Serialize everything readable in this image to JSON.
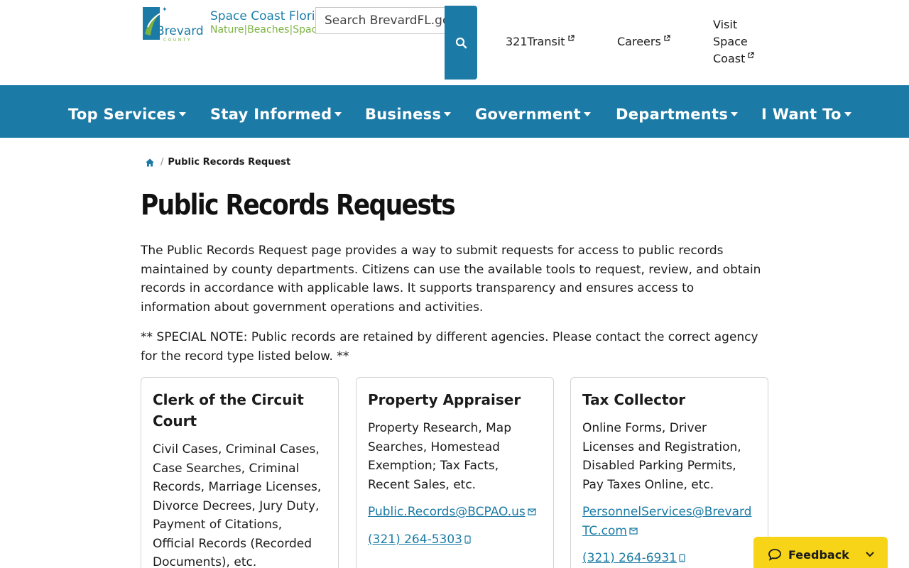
{
  "header": {
    "logo": {
      "word": "Brevard",
      "sub": "COUNTY"
    },
    "site_title": "Space Coast Florida",
    "tagline": [
      "Nature",
      "Beaches",
      "Space"
    ],
    "search": {
      "placeholder": "Search BrevardFL.gov"
    },
    "util_links": [
      {
        "label": "321Transit"
      },
      {
        "label": "Careers"
      },
      {
        "label": "Visit Space Coast"
      }
    ]
  },
  "nav": {
    "items": [
      {
        "label": "Top Services"
      },
      {
        "label": "Stay Informed"
      },
      {
        "label": "Business"
      },
      {
        "label": "Government"
      },
      {
        "label": "Departments"
      },
      {
        "label": "I Want To"
      }
    ]
  },
  "breadcrumb": {
    "current": "Public Records Request"
  },
  "page": {
    "title": "Public Records Requests",
    "intro": "The Public Records Request page provides a way to submit requests for access to public records maintained by county departments. Citizens can use the available tools to request, review, and obtain records in accordance with applicable laws. It supports transparency and ensures access to information about government operations and activities.",
    "note": "** SPECIAL NOTE: Public records are retained by different agencies. Please contact the correct agency for the record type listed below. **"
  },
  "cards": [
    {
      "title": "Clerk of the Circuit Court",
      "desc": "Civil Cases, Criminal Cases, Case Searches, Criminal Records, Marriage Licenses, Divorce Decrees, Jury Duty, Payment of Citations, Official Records (Recorded Documents), etc."
    },
    {
      "title": "Property Appraiser",
      "desc": "Property Research, Map Searches, Homestead Exemption; Tax Facts, Recent Sales, etc.",
      "email": "Public.Records@BCPAO.us",
      "phone": "(321) 264-5303"
    },
    {
      "title": "Tax Collector",
      "desc": "Online Forms, Driver Licenses and Registration, Disabled Parking Permits, Pay Taxes Online, etc.",
      "email": "PersonnelServices@BrevardTC.com",
      "phone": "(321) 264-6931"
    }
  ],
  "feedback": {
    "label": "Feedback"
  },
  "colors": {
    "brand_blue": "#1b7ba6",
    "accent_green": "#7cb342",
    "feedback_yellow": "#f7d417"
  }
}
